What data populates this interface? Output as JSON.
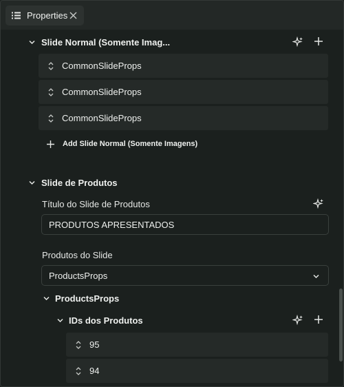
{
  "tab": {
    "label": "Properties"
  },
  "section_slide_normal": {
    "title": "Slide Normal (Somente Imag...",
    "items": [
      "CommonSlideProps",
      "CommonSlideProps",
      "CommonSlideProps"
    ],
    "add_label": "Add Slide Normal (Somente Imagens)"
  },
  "section_slide_produtos": {
    "title": "Slide de Produtos",
    "titulo_label": "Título do Slide de Produtos",
    "titulo_value": "PRODUTOS APRESENTADOS",
    "produtos_label": "Produtos do Slide",
    "produtos_value": "ProductsProps",
    "products_props_title": "ProductsProps",
    "ids_title": "IDs dos Produtos",
    "ids": [
      "95",
      "94"
    ]
  },
  "icons": {
    "tab": "list-icon",
    "close": "close-icon",
    "sparkle": "sparkle-icon",
    "plus": "plus-icon",
    "grip": "drag-handle-icon",
    "chevron": "chevron-down-icon"
  },
  "colors": {
    "background": "#1b201e",
    "item_background": "#252a28",
    "tab_background": "#2d3230",
    "border": "#3a403d",
    "text": "#eef0ee"
  }
}
